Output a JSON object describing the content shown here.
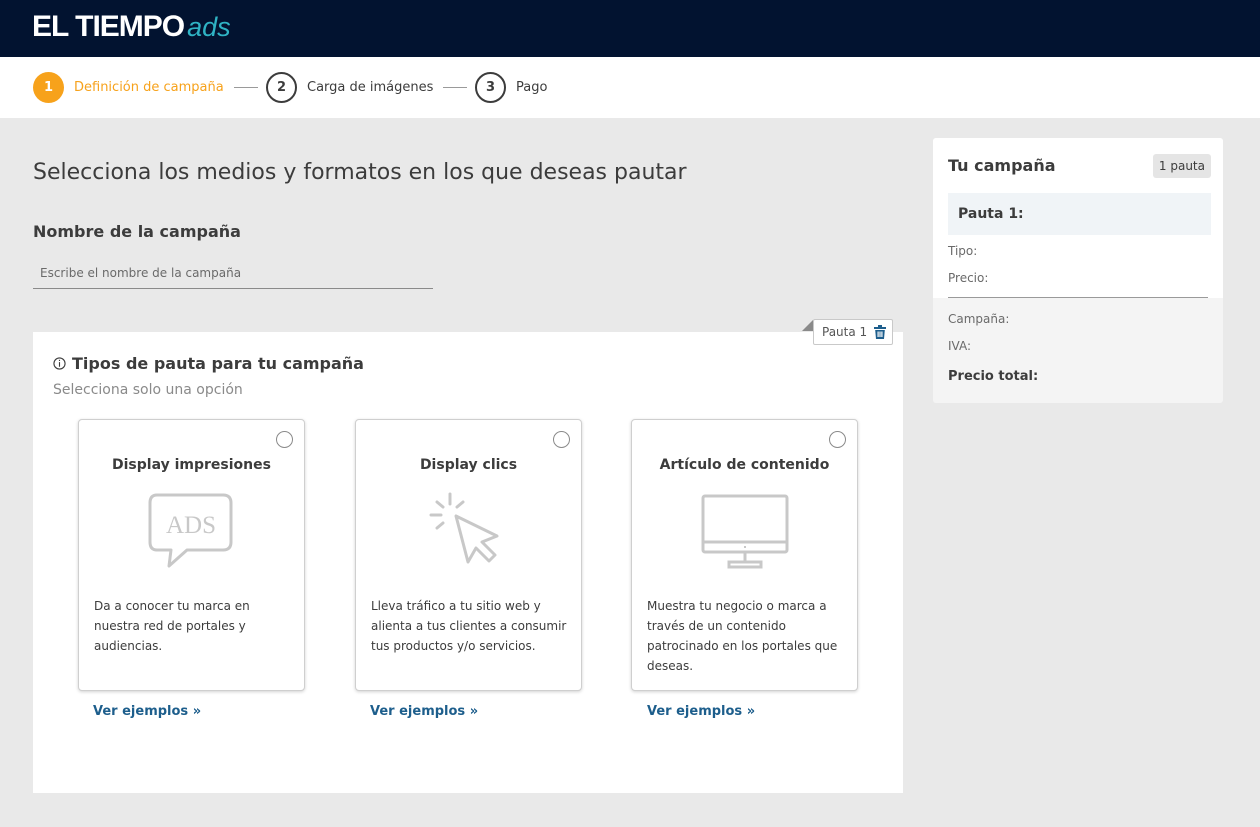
{
  "header": {
    "logo_main": "EL TIEMPO",
    "logo_ads": "ads"
  },
  "stepper": {
    "steps": [
      {
        "number": "1",
        "label": "Definición de campaña",
        "active": true
      },
      {
        "number": "2",
        "label": "Carga de imágenes",
        "active": false
      },
      {
        "number": "3",
        "label": "Pago",
        "active": false
      }
    ]
  },
  "main": {
    "title": "Selecciona los medios y formatos en los que deseas pautar",
    "campaign_name_label": "Nombre de la campaña",
    "campaign_name_placeholder": "Escribe el nombre de la campaña",
    "campaign_name_value": ""
  },
  "pauta_panel": {
    "tag_label": "Pauta 1",
    "title": "Tipos de pauta para tu campaña",
    "subtitle": "Selecciona solo una opción",
    "cards": [
      {
        "title": "Display impresiones",
        "icon": "ads-speech-bubble-icon",
        "description": "Da a conocer tu marca en nuestra red de portales y audiencias.",
        "link": "Ver ejemplos »",
        "selected": false
      },
      {
        "title": "Display clics",
        "icon": "cursor-click-icon",
        "description": "Lleva tráfico a tu sitio web y alienta a tus clientes a consumir tus productos y/o servicios.",
        "link": "Ver ejemplos »",
        "selected": false
      },
      {
        "title": "Artículo de contenido",
        "icon": "monitor-icon",
        "description": "Muestra tu negocio o marca a través de un contenido patrocinado en los portales que deseas.",
        "link": "Ver ejemplos »",
        "selected": false
      }
    ]
  },
  "summary": {
    "title": "Tu campaña",
    "badge": "1 pauta",
    "pauta_label": "Pauta 1:",
    "tipo_label": "Tipo:",
    "precio_label": "Precio:",
    "campana_label": "Campaña:",
    "iva_label": "IVA:",
    "total_label": "Precio total:"
  },
  "colors": {
    "header_bg": "#021330",
    "accent_orange": "#f7a21b",
    "logo_ads": "#2fb3c4",
    "link_blue": "#1d5e8c",
    "trash_blue": "#1d5e8c"
  }
}
